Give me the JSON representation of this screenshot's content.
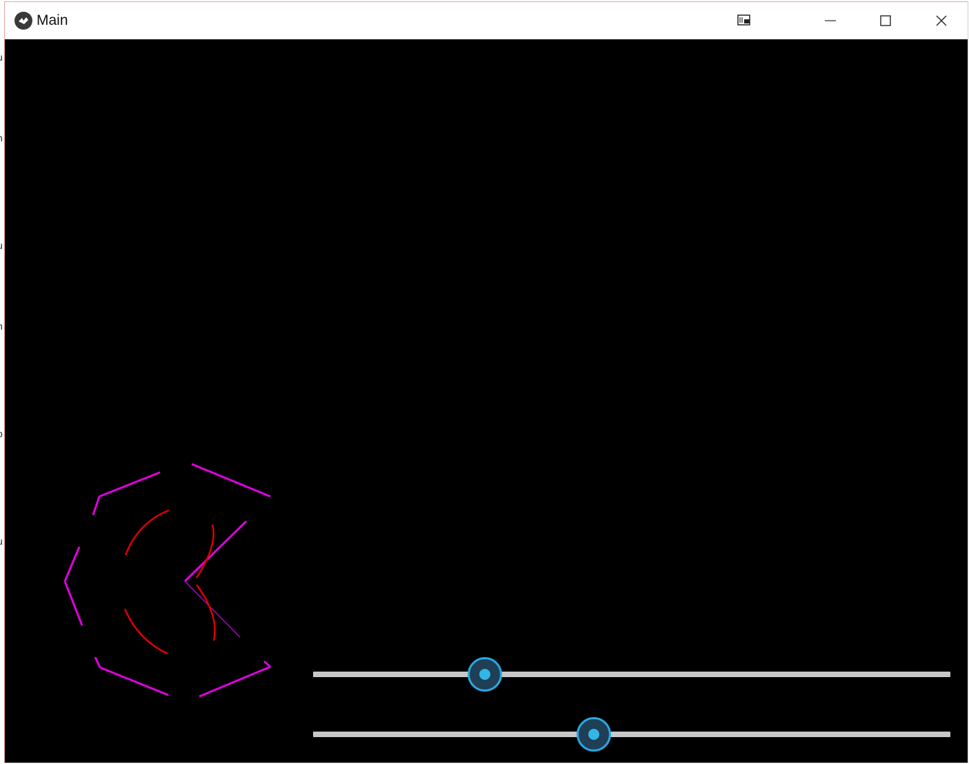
{
  "window": {
    "title": "Main",
    "icons": {
      "app": "kivy-app-icon",
      "pin": "picture-in-picture-icon",
      "minimize": "minimize-icon",
      "maximize": "maximize-icon",
      "close": "close-icon"
    }
  },
  "left_strip_chars": [
    "u",
    "n",
    "u",
    "n",
    "p",
    "u"
  ],
  "colors": {
    "canvas": "#000000",
    "magenta": "#e000e0",
    "red": "#e00000",
    "slider_track": "#c8c8c8",
    "slider_thumb": "#33b5e5"
  },
  "sliders": [
    {
      "name": "slider-1",
      "value": 0.27
    },
    {
      "name": "slider-2",
      "value": 0.44
    }
  ]
}
